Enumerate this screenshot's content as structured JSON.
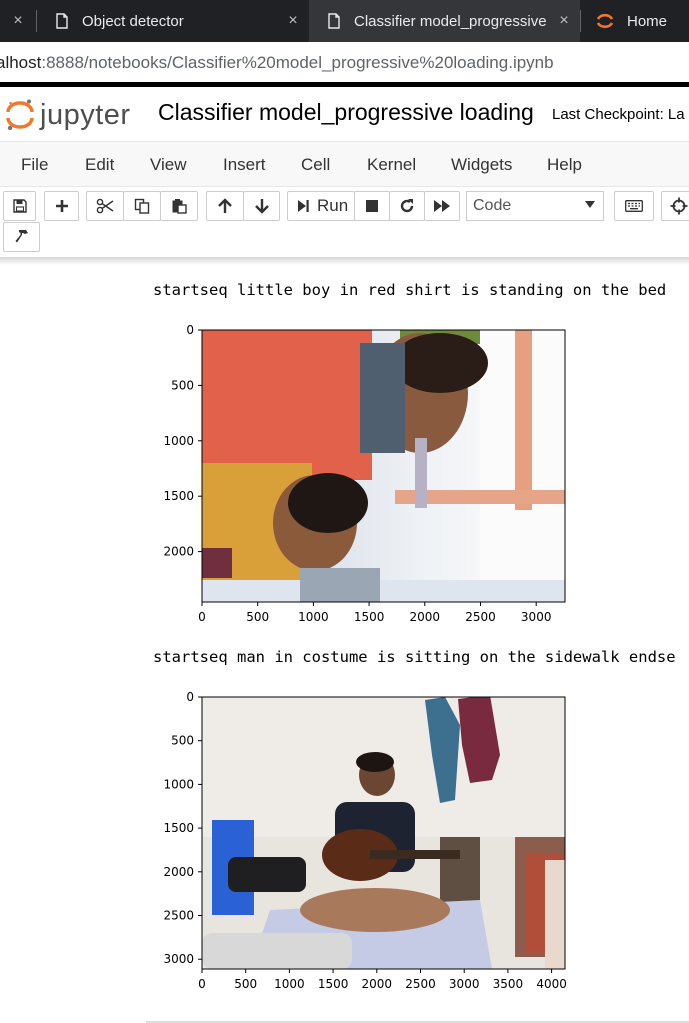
{
  "browser": {
    "tabs": [
      {
        "label": "Object detector",
        "icon": "page-icon",
        "active": false
      },
      {
        "label": "Classifier model_progressive",
        "icon": "page-icon",
        "active": true
      },
      {
        "label": "Home",
        "icon": "jupyter-icon",
        "active": false
      }
    ],
    "close_glyph": "×",
    "url_host": "alhost",
    "url_rest": ":8888/notebooks/Classifier%20model_progressive%20loading.ipynb"
  },
  "header": {
    "logo_text": "jupyter",
    "notebook_title": "Classifier model_progressive loading",
    "checkpoint": "Last Checkpoint: La"
  },
  "menu": [
    "File",
    "Edit",
    "View",
    "Insert",
    "Cell",
    "Kernel",
    "Widgets",
    "Help"
  ],
  "toolbar": {
    "run_label": "Run",
    "cell_type": "Code"
  },
  "outputs": [
    {
      "caption": "startseq little boy in red shirt is standing on the bed",
      "xticks": [
        "0",
        "500",
        "1000",
        "1500",
        "2000",
        "2500",
        "3000"
      ],
      "yticks": [
        "0",
        "500",
        "1000",
        "1500",
        "2000"
      ]
    },
    {
      "caption": "startseq man in costume is sitting on the sidewalk endse",
      "xticks": [
        "0",
        "500",
        "1000",
        "1500",
        "2000",
        "2500",
        "3000",
        "3500",
        "4000"
      ],
      "yticks": [
        "0",
        "500",
        "1000",
        "1500",
        "2000",
        "2500",
        "3000"
      ]
    }
  ],
  "colors": {
    "tab_bg": "#202124",
    "tab_active": "#35363a",
    "jupyter_orange": "#f37726",
    "menubar_bg": "#f8f8f8"
  }
}
